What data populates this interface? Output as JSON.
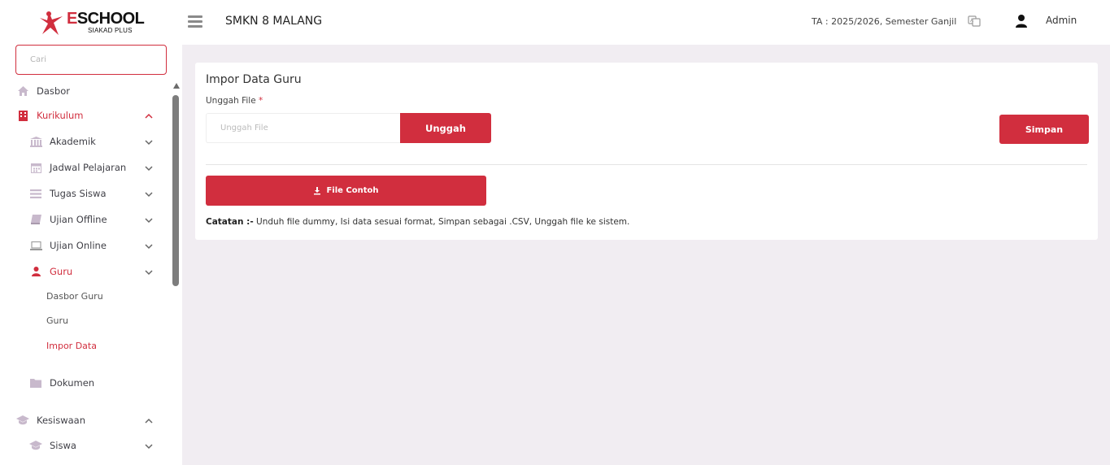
{
  "brand": {
    "title_first": "E",
    "title_rest": "SCHOOL",
    "subtitle": "SIAKAD PLUS",
    "accent_color": "#d12e3e"
  },
  "header": {
    "school_name": "SMKN 8 MALANG",
    "academic_year": "TA : 2025/2026, Semester Ganjil",
    "user_name": "Admin"
  },
  "sidebar": {
    "search_placeholder": "Cari",
    "items": [
      {
        "label": "Dasbor",
        "icon": "home-icon"
      },
      {
        "label": "Kurikulum",
        "icon": "building-icon",
        "expanded": true
      },
      {
        "label": "Akademik",
        "icon": "institution-icon"
      },
      {
        "label": "Jadwal Pelajaran",
        "icon": "calendar-icon"
      },
      {
        "label": "Tugas Siswa",
        "icon": "list-icon"
      },
      {
        "label": "Ujian Offline",
        "icon": "book-icon"
      },
      {
        "label": "Ujian Online",
        "icon": "laptop-icon"
      },
      {
        "label": "Guru",
        "icon": "user-icon",
        "expanded": true
      },
      {
        "label": "Dokumen",
        "icon": "folder-icon"
      },
      {
        "label": "Kesiswaan",
        "icon": "graduation-cap-icon",
        "expanded": true
      },
      {
        "label": "Siswa",
        "icon": "graduation-cap-icon"
      }
    ],
    "guru_sub": [
      "Dasbor Guru",
      "Guru",
      "Impor Data"
    ]
  },
  "main": {
    "card_title": "Impor Data Guru",
    "file_label": "Unggah File",
    "required_mark": "*",
    "file_placeholder": "Unggah File",
    "upload_button": "Unggah",
    "save_button": "Simpan",
    "sample_button": "File Contoh",
    "note_label": "Catatan :-",
    "note_text": " Unduh file dummy, Isi data sesuai format, Simpan sebagai .CSV, Unggah file ke sistem."
  }
}
